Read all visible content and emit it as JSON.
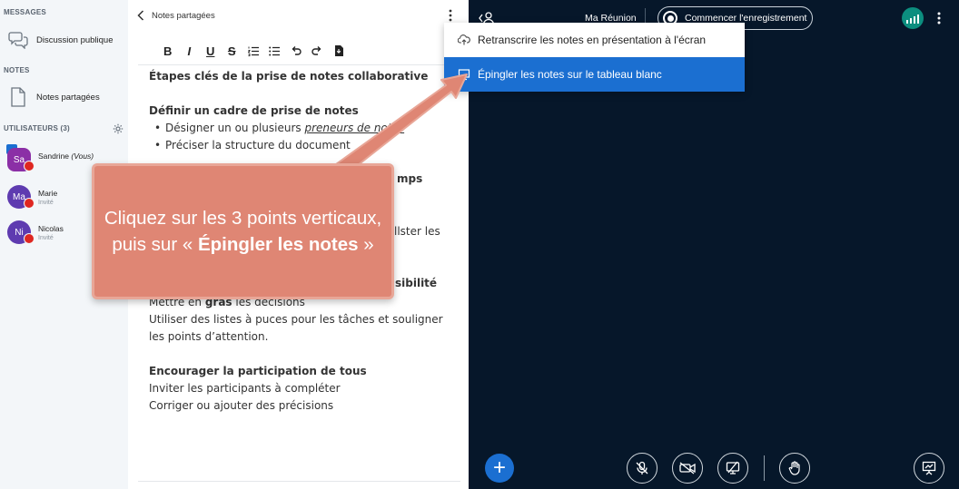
{
  "sidebar": {
    "messages_title": "MESSAGES",
    "public_chat": "Discussion publique",
    "notes_title": "NOTES",
    "shared_notes": "Notes partagées",
    "users_title": "UTILISATEURS (3)",
    "users": [
      {
        "initials": "Sa",
        "name": "Sandrine",
        "suffix": "(Vous)",
        "role": "",
        "color": "#8b2fa6"
      },
      {
        "initials": "Ma",
        "name": "Marie",
        "suffix": "",
        "role": "Invité",
        "color": "#5e3bb0"
      },
      {
        "initials": "Ni",
        "name": "Nicolas",
        "suffix": "",
        "role": "Invité",
        "color": "#5e3bb0"
      }
    ]
  },
  "notes": {
    "title": "Notes partagées",
    "h1": "Étapes clés de la prise de notes collaborative",
    "h2": "Définir un cadre de prise de notes",
    "li1_pre": "Désigner un ou plusieurs ",
    "li1_em": "preneurs de notes",
    "li2": "Préciser la structure du document",
    "peek1": "mps",
    "peek2": "llster les",
    "peek3": "sibilité",
    "p1_pre": "Mettre en ",
    "p1_bold": "gras",
    "p1_post": " les décisions",
    "p2": "Utiliser des listes à puces pour les tâches et souligner",
    "p3": "les points d’attention.",
    "h3": "Encourager la participation de tous",
    "p4": "Inviter les participants à compléter",
    "p5": "Corriger ou ajouter des précisions"
  },
  "meeting": {
    "title": "Ma Réunion",
    "record_label": "Commencer l'enregistrement",
    "accent": "#1b6fd1",
    "background": "#06172a"
  },
  "menu": {
    "item1": "Retranscrire les notes en présentation à l'écran",
    "item2": "Épingler les notes sur le tableau blanc"
  },
  "callout": {
    "text1": "Cliquez sur les 3 points verticaux, puis sur « ",
    "bold": "Épingler les notes",
    "text2": " »",
    "color": "#df8674"
  }
}
